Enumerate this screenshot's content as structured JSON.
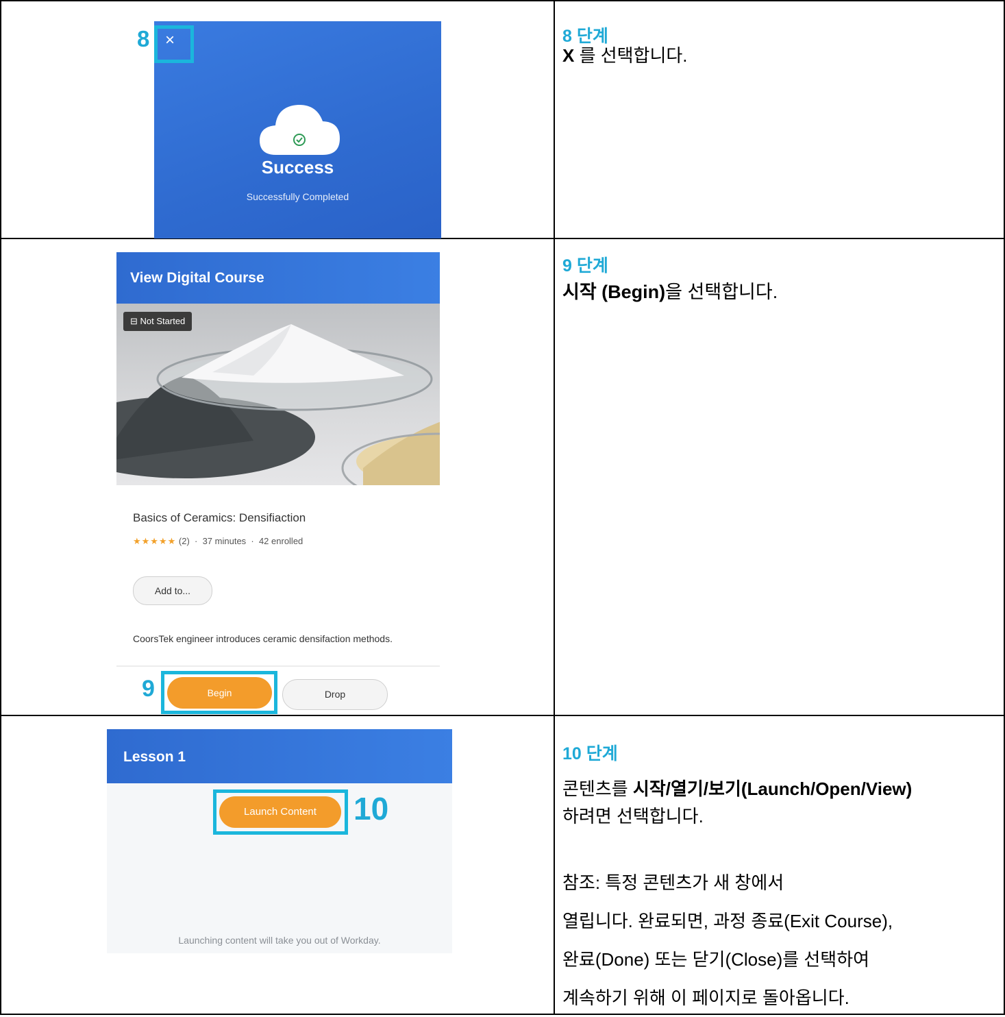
{
  "rows": [
    {
      "step_title": "8 단계",
      "callout": "8",
      "text_bold": "X",
      "text_rest": " 를 선택합니다.",
      "panel": {
        "close_glyph": "×",
        "title": "Success",
        "subtitle": "Successfully Completed"
      }
    },
    {
      "step_title": "9 단계",
      "callout": "9",
      "text_bold": "시작 (Begin)",
      "text_rest": "을 선택합니다.",
      "panel": {
        "header": "View Digital Course",
        "badge": "Not Started",
        "course_title": "Basics of Ceramics: Densifiaction",
        "stars": "★★★★★",
        "rating_count": "(2)",
        "duration": "37 minutes",
        "enrolled": "42 enrolled",
        "add_to": "Add to...",
        "description": "CoorsTek engineer introduces ceramic densifaction methods.",
        "begin": "Begin",
        "drop": "Drop"
      }
    },
    {
      "step_title": "10 단계",
      "callout": "10",
      "text_prefix": "콘텐츠를 ",
      "text_bold": "시작/열기/보기(Launch/Open/View)",
      "text_rest": "하려면 선택합니다.",
      "note_lines": [
        "참조: 특정 콘텐츠가 새 창에서",
        "열립니다. 완료되면, 과정 종료(Exit Course),",
        "완료(Done) 또는 닫기(Close)를 선택하여",
        "계속하기 위해 이 페이지로 돌아옵니다."
      ],
      "panel": {
        "header": "Lesson 1",
        "launch": "Launch Content",
        "note": "Launching content will take you out of Workday."
      }
    }
  ],
  "colors": {
    "accent": "#1fa9d6",
    "highlight_box": "#1bb6dc",
    "header_blue": "#2f6bd0",
    "button_orange": "#f39c2b"
  }
}
